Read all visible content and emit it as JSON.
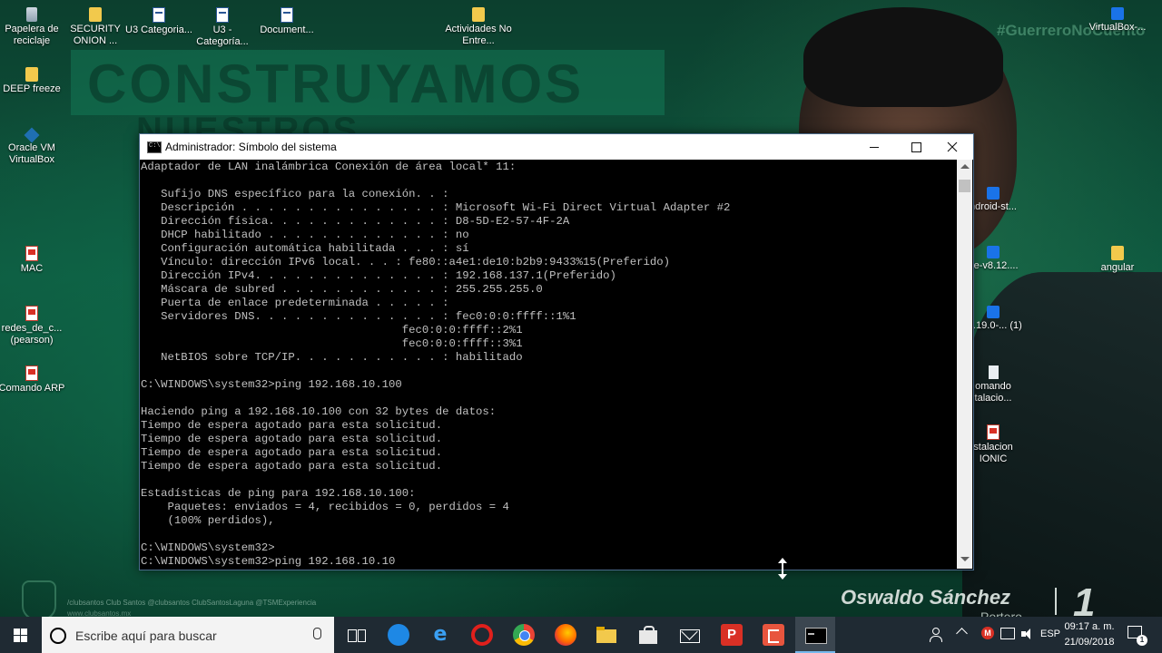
{
  "wallpaper": {
    "banner": "CONSTRUYAMOS",
    "banner_sub": "NUESTROS",
    "hashtag": "#GuerreroNoCuento",
    "player_name": "Oswaldo Sánchez",
    "player_role": "Portero",
    "player_number": "1",
    "social_line": "/clubsantos  Club Santos  @clubsantos  ClubSantosLaguna  @TSMExperiencia",
    "site": "www.clubsantos.mx"
  },
  "desktop_icons": [
    {
      "label": "Papelera de reciclaje",
      "icon": "recycle-bin-icon"
    },
    {
      "label": "SECURITY ONION ...",
      "icon": "folder-icon"
    },
    {
      "label": "U3 Categoria...",
      "icon": "word-document-icon"
    },
    {
      "label": "U3 - Categoría...",
      "icon": "word-document-icon"
    },
    {
      "label": "Document...",
      "icon": "word-document-icon"
    },
    {
      "label": "Actividades No Entre...",
      "icon": "folder-icon"
    },
    {
      "label": "VirtualBox-...",
      "icon": "installer-icon"
    },
    {
      "label": "DEEP freeze",
      "icon": "folder-icon"
    },
    {
      "label": "Oracle VM VirtualBox",
      "icon": "virtualbox-icon"
    },
    {
      "label": "MAC",
      "icon": "pdf-icon"
    },
    {
      "label": "redes_de_c... (pearson)",
      "icon": "pdf-icon"
    },
    {
      "label": "Comando ARP",
      "icon": "pdf-icon"
    },
    {
      "label": "ndroid-st...",
      "icon": "app-icon"
    },
    {
      "label": "de-v8.12....",
      "icon": "installer-icon"
    },
    {
      "label": "angular",
      "icon": "folder-icon"
    },
    {
      "label": "-2.19.0-... (1)",
      "icon": "installer-icon"
    },
    {
      "label": "omando talacio...",
      "icon": "document-icon"
    },
    {
      "label": "stalacion IONIC",
      "icon": "pdf-icon"
    }
  ],
  "cmd_window": {
    "title": "Administrador: Símbolo del sistema",
    "minimize": "minimize",
    "maximize": "maximize",
    "close": "close",
    "lines": [
      "Adaptador de LAN inalámbrica Conexión de área local* 11:",
      "",
      "   Sufijo DNS específico para la conexión. . :",
      "   Descripción . . . . . . . . . . . . . . . : Microsoft Wi-Fi Direct Virtual Adapter #2",
      "   Dirección física. . . . . . . . . . . . . : D8-5D-E2-57-4F-2A",
      "   DHCP habilitado . . . . . . . . . . . . . : no",
      "   Configuración automática habilitada . . . : sí",
      "   Vínculo: dirección IPv6 local. . . : fe80::a4e1:de10:b2b9:9433%15(Preferido)",
      "   Dirección IPv4. . . . . . . . . . . . . . : 192.168.137.1(Preferido)",
      "   Máscara de subred . . . . . . . . . . . . : 255.255.255.0",
      "   Puerta de enlace predeterminada . . . . . :",
      "   Servidores DNS. . . . . . . . . . . . . . : fec0:0:0:ffff::1%1",
      "                                       fec0:0:0:ffff::2%1",
      "                                       fec0:0:0:ffff::3%1",
      "   NetBIOS sobre TCP/IP. . . . . . . . . . . : habilitado",
      "",
      "C:\\WINDOWS\\system32>ping 192.168.10.100",
      "",
      "Haciendo ping a 192.168.10.100 con 32 bytes de datos:",
      "Tiempo de espera agotado para esta solicitud.",
      "Tiempo de espera agotado para esta solicitud.",
      "Tiempo de espera agotado para esta solicitud.",
      "Tiempo de espera agotado para esta solicitud.",
      "",
      "Estadísticas de ping para 192.168.10.100:",
      "    Paquetes: enviados = 4, recibidos = 0, perdidos = 4",
      "    (100% perdidos),",
      "",
      "C:\\WINDOWS\\system32>",
      "C:\\WINDOWS\\system32>ping 192.168.10.10"
    ]
  },
  "taskbar": {
    "search_placeholder": "Escribe aquí para buscar",
    "apps": [
      "task-view",
      "edge",
      "internet-explorer",
      "opera",
      "chrome",
      "firefox",
      "file-explorer",
      "store",
      "mail",
      "app-p",
      "app-c",
      "command-prompt"
    ],
    "app_p_letter": "P",
    "tray_m": "M",
    "language": "ESP",
    "time": "09:17 a. m.",
    "date": "21/09/2018",
    "notification_count": "1"
  }
}
